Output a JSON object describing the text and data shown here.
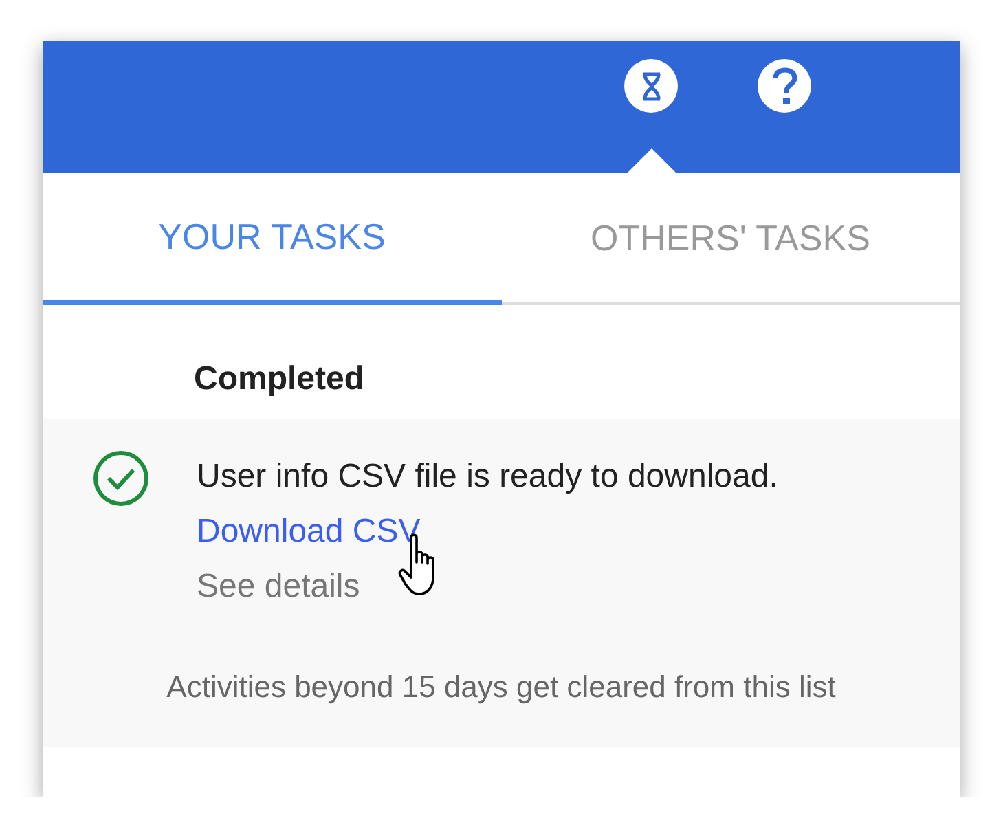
{
  "header": {
    "icons": [
      {
        "kind": "hourglass",
        "selected": true
      },
      {
        "kind": "help",
        "selected": false
      }
    ]
  },
  "tabs": [
    {
      "label": "YOUR TASKS",
      "selected": true
    },
    {
      "label": "OTHERS' TASKS",
      "selected": false
    }
  ],
  "section": {
    "title": "Completed"
  },
  "tasks": [
    {
      "kind": "completed",
      "message": "User info CSV file is ready to download.",
      "link": "Download CSV",
      "details": "See details",
      "hovered": true
    }
  ],
  "footer": "Activities beyond 15 days get cleared from this list"
}
